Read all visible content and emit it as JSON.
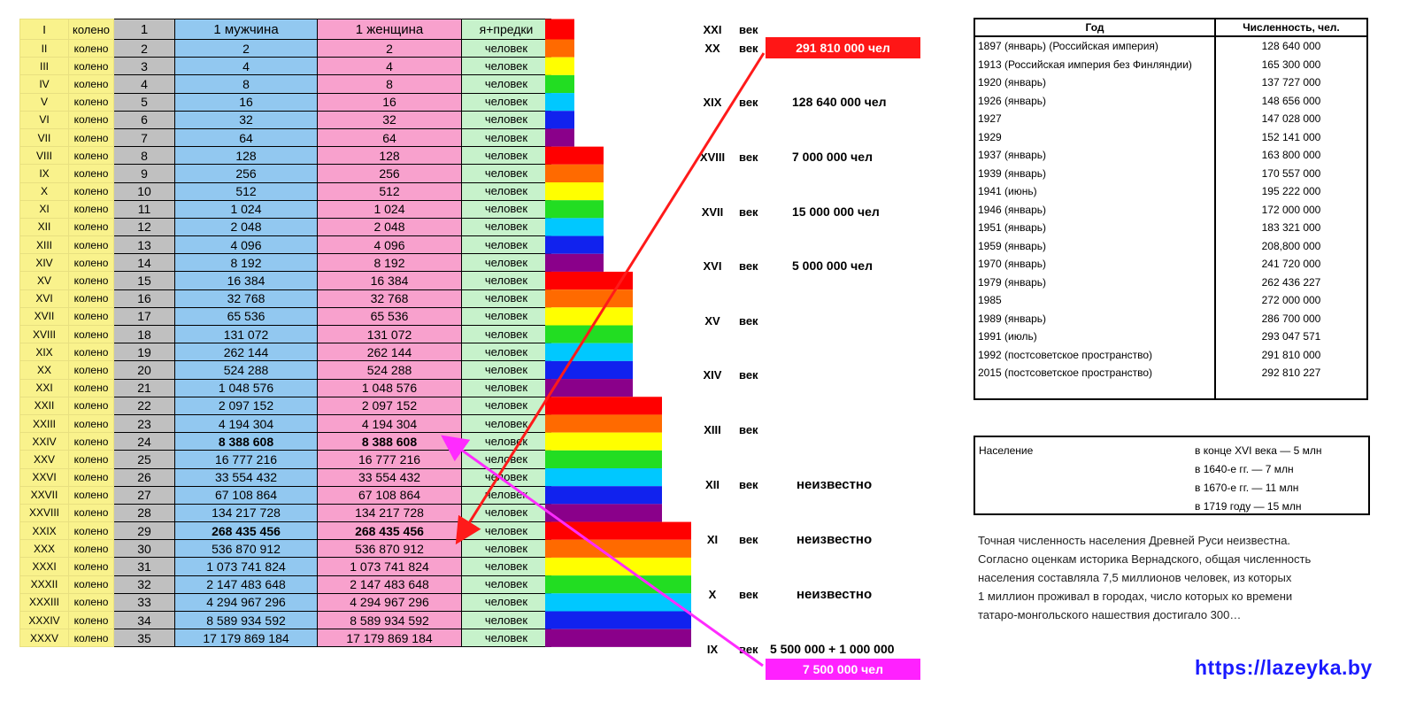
{
  "generations_table": {
    "headers": {
      "roman": "I",
      "kol": "колено",
      "num": "1",
      "men": "1 мужчина",
      "women": "1 женщина",
      "ancestors": "я+предки"
    },
    "rows": [
      {
        "roman": "II",
        "kol": "колено",
        "num": "2",
        "men": "2",
        "women": "2",
        "anc": "человек"
      },
      {
        "roman": "III",
        "kol": "колено",
        "num": "3",
        "men": "4",
        "women": "4",
        "anc": "человек"
      },
      {
        "roman": "IV",
        "kol": "колено",
        "num": "4",
        "men": "8",
        "women": "8",
        "anc": "человек"
      },
      {
        "roman": "V",
        "kol": "колено",
        "num": "5",
        "men": "16",
        "women": "16",
        "anc": "человек"
      },
      {
        "roman": "VI",
        "kol": "колено",
        "num": "6",
        "men": "32",
        "women": "32",
        "anc": "человек"
      },
      {
        "roman": "VII",
        "kol": "колено",
        "num": "7",
        "men": "64",
        "women": "64",
        "anc": "человек"
      },
      {
        "roman": "VIII",
        "kol": "колено",
        "num": "8",
        "men": "128",
        "women": "128",
        "anc": "человек"
      },
      {
        "roman": "IX",
        "kol": "колено",
        "num": "9",
        "men": "256",
        "women": "256",
        "anc": "человек"
      },
      {
        "roman": "X",
        "kol": "колено",
        "num": "10",
        "men": "512",
        "women": "512",
        "anc": "человек"
      },
      {
        "roman": "XI",
        "kol": "колено",
        "num": "11",
        "men": "1 024",
        "women": "1 024",
        "anc": "человек"
      },
      {
        "roman": "XII",
        "kol": "колено",
        "num": "12",
        "men": "2 048",
        "women": "2 048",
        "anc": "человек"
      },
      {
        "roman": "XIII",
        "kol": "колено",
        "num": "13",
        "men": "4 096",
        "women": "4 096",
        "anc": "человек"
      },
      {
        "roman": "XIV",
        "kol": "колено",
        "num": "14",
        "men": "8 192",
        "women": "8 192",
        "anc": "человек"
      },
      {
        "roman": "XV",
        "kol": "колено",
        "num": "15",
        "men": "16 384",
        "women": "16 384",
        "anc": "человек"
      },
      {
        "roman": "XVI",
        "kol": "колено",
        "num": "16",
        "men": "32 768",
        "women": "32 768",
        "anc": "человек"
      },
      {
        "roman": "XVII",
        "kol": "колено",
        "num": "17",
        "men": "65 536",
        "women": "65 536",
        "anc": "человек"
      },
      {
        "roman": "XVIII",
        "kol": "колено",
        "num": "18",
        "men": "131 072",
        "women": "131 072",
        "anc": "человек"
      },
      {
        "roman": "XIX",
        "kol": "колено",
        "num": "19",
        "men": "262 144",
        "women": "262 144",
        "anc": "человек"
      },
      {
        "roman": "XX",
        "kol": "колено",
        "num": "20",
        "men": "524 288",
        "women": "524 288",
        "anc": "человек"
      },
      {
        "roman": "XXI",
        "kol": "колено",
        "num": "21",
        "men": "1 048 576",
        "women": "1 048 576",
        "anc": "человек"
      },
      {
        "roman": "XXII",
        "kol": "колено",
        "num": "22",
        "men": "2 097 152",
        "women": "2 097 152",
        "anc": "человек"
      },
      {
        "roman": "XXIII",
        "kol": "колено",
        "num": "23",
        "men": "4 194 304",
        "women": "4 194 304",
        "anc": "человек"
      },
      {
        "roman": "XXIV",
        "kol": "колено",
        "num": "24",
        "men": "8 388 608",
        "women": "8 388 608",
        "anc": "человек",
        "bold": true
      },
      {
        "roman": "XXV",
        "kol": "колено",
        "num": "25",
        "men": "16 777 216",
        "women": "16 777 216",
        "anc": "человек"
      },
      {
        "roman": "XXVI",
        "kol": "колено",
        "num": "26",
        "men": "33 554 432",
        "women": "33 554 432",
        "anc": "человек"
      },
      {
        "roman": "XXVII",
        "kol": "колено",
        "num": "27",
        "men": "67 108 864",
        "women": "67 108 864",
        "anc": "человек"
      },
      {
        "roman": "XXVIII",
        "kol": "колено",
        "num": "28",
        "men": "134 217 728",
        "women": "134 217 728",
        "anc": "человек"
      },
      {
        "roman": "XXIX",
        "kol": "колено",
        "num": "29",
        "men": "268 435 456",
        "women": "268 435 456",
        "anc": "человек",
        "bold": true
      },
      {
        "roman": "XXX",
        "kol": "колено",
        "num": "30",
        "men": "536 870 912",
        "women": "536 870 912",
        "anc": "человек"
      },
      {
        "roman": "XXXI",
        "kol": "колено",
        "num": "31",
        "men": "1 073 741 824",
        "women": "1 073 741 824",
        "anc": "человек"
      },
      {
        "roman": "XXXII",
        "kol": "колено",
        "num": "32",
        "men": "2 147 483 648",
        "women": "2 147 483 648",
        "anc": "человек"
      },
      {
        "roman": "XXXIII",
        "kol": "колено",
        "num": "33",
        "men": "4 294 967 296",
        "women": "4 294 967 296",
        "anc": "человек"
      },
      {
        "roman": "XXXIV",
        "kol": "колено",
        "num": "34",
        "men": "8 589 934 592",
        "women": "8 589 934 592",
        "anc": "человек"
      },
      {
        "roman": "XXXV",
        "kol": "колено",
        "num": "35",
        "men": "17 179 869 184",
        "women": "17 179 869 184",
        "anc": "человек"
      }
    ]
  },
  "rainbow": {
    "colors": [
      "#ff0000",
      "#ff6a00",
      "#ffff00",
      "#22dd22",
      "#00c8ff",
      "#1122ee",
      "#8a008a"
    ],
    "group_size": 7
  },
  "centuries": [
    {
      "roman": "XXI",
      "word": "век",
      "value": ""
    },
    {
      "roman": "XX",
      "word": "век",
      "value": "291 810 000 чел"
    },
    {
      "roman": "XIX",
      "word": "век",
      "value": "128 640 000 чел"
    },
    {
      "roman": "XVIII",
      "word": "век",
      "value": "7 000 000 чел"
    },
    {
      "roman": "XVII",
      "word": "век",
      "value": "15 000 000 чел"
    },
    {
      "roman": "XVI",
      "word": "век",
      "value": "5 000 000 чел"
    },
    {
      "roman": "XV",
      "word": "век",
      "value": ""
    },
    {
      "roman": "XIV",
      "word": "век",
      "value": ""
    },
    {
      "roman": "XIII",
      "word": "век",
      "value": ""
    },
    {
      "roman": "XII",
      "word": "век",
      "value": "неизвестно"
    },
    {
      "roman": "XI",
      "word": "век",
      "value": "неизвестно"
    },
    {
      "roman": "X",
      "word": "век",
      "value": "неизвестно"
    },
    {
      "roman": "IX",
      "word": "век",
      "value": "5 500 000  +  1 000 000"
    }
  ],
  "pink_total": "7 500 000 чел",
  "census": {
    "header_year": "Год",
    "header_count": "Численность, чел.",
    "rows": [
      {
        "year": "1897 (январь) (Российская империя)",
        "count": "128 640 000"
      },
      {
        "year": "1913 (Российская империя без Финляндии)",
        "count": "165 300 000"
      },
      {
        "year": "1920 (январь)",
        "count": "137 727 000"
      },
      {
        "year": "1926 (январь)",
        "count": "148 656 000"
      },
      {
        "year": "1927",
        "count": "147 028 000"
      },
      {
        "year": "1929",
        "count": "152 141 000"
      },
      {
        "year": "1937 (январь)",
        "count": "163 800 000"
      },
      {
        "year": "1939 (январь)",
        "count": "170 557 000"
      },
      {
        "year": "1941 (июнь)",
        "count": "195 222 000"
      },
      {
        "year": "1946 (январь)",
        "count": "172 000 000"
      },
      {
        "year": "1951 (январь)",
        "count": "183 321 000"
      },
      {
        "year": "1959 (январь)",
        "count": "208,800 000"
      },
      {
        "year": "1970 (январь)",
        "count": "241 720 000"
      },
      {
        "year": "1979 (январь)",
        "count": "262 436 227"
      },
      {
        "year": "1985",
        "count": "272 000 000"
      },
      {
        "year": "1989 (январь)",
        "count": "286 700 000"
      },
      {
        "year": "1991 (июль)",
        "count": "293 047 571"
      },
      {
        "year": "1992 (постсоветское пространство)",
        "count": "291 810 000"
      },
      {
        "year": "2015 (постсоветское пространство)",
        "count": "292 810 227"
      }
    ]
  },
  "population_box": {
    "label": "Население",
    "lines": [
      "в конце XVI века — 5 млн",
      "в 1640-е гг. — 7 млн",
      "в 1670-е гг. — 11 млн",
      "в 1719 году — 15 млн"
    ]
  },
  "note_lines": [
    "Точная численность населения Древней Руси неизвестна.",
    "Согласно оценкам историка Вернадского, общая численность",
    "населения составляла 7,5 миллионов человек, из которых",
    " 1 миллион проживал в городах, число которых ко времени",
    "татаро-монгольского нашествия достигало 300…"
  ],
  "website": "https://lazeyka.by",
  "colors": {
    "red_box": "#ff1616",
    "pink_box": "#ff21ff",
    "red_arrow": "#ff1a1a",
    "pink_arrow": "#ff2bff",
    "website": "#1a1aff"
  }
}
